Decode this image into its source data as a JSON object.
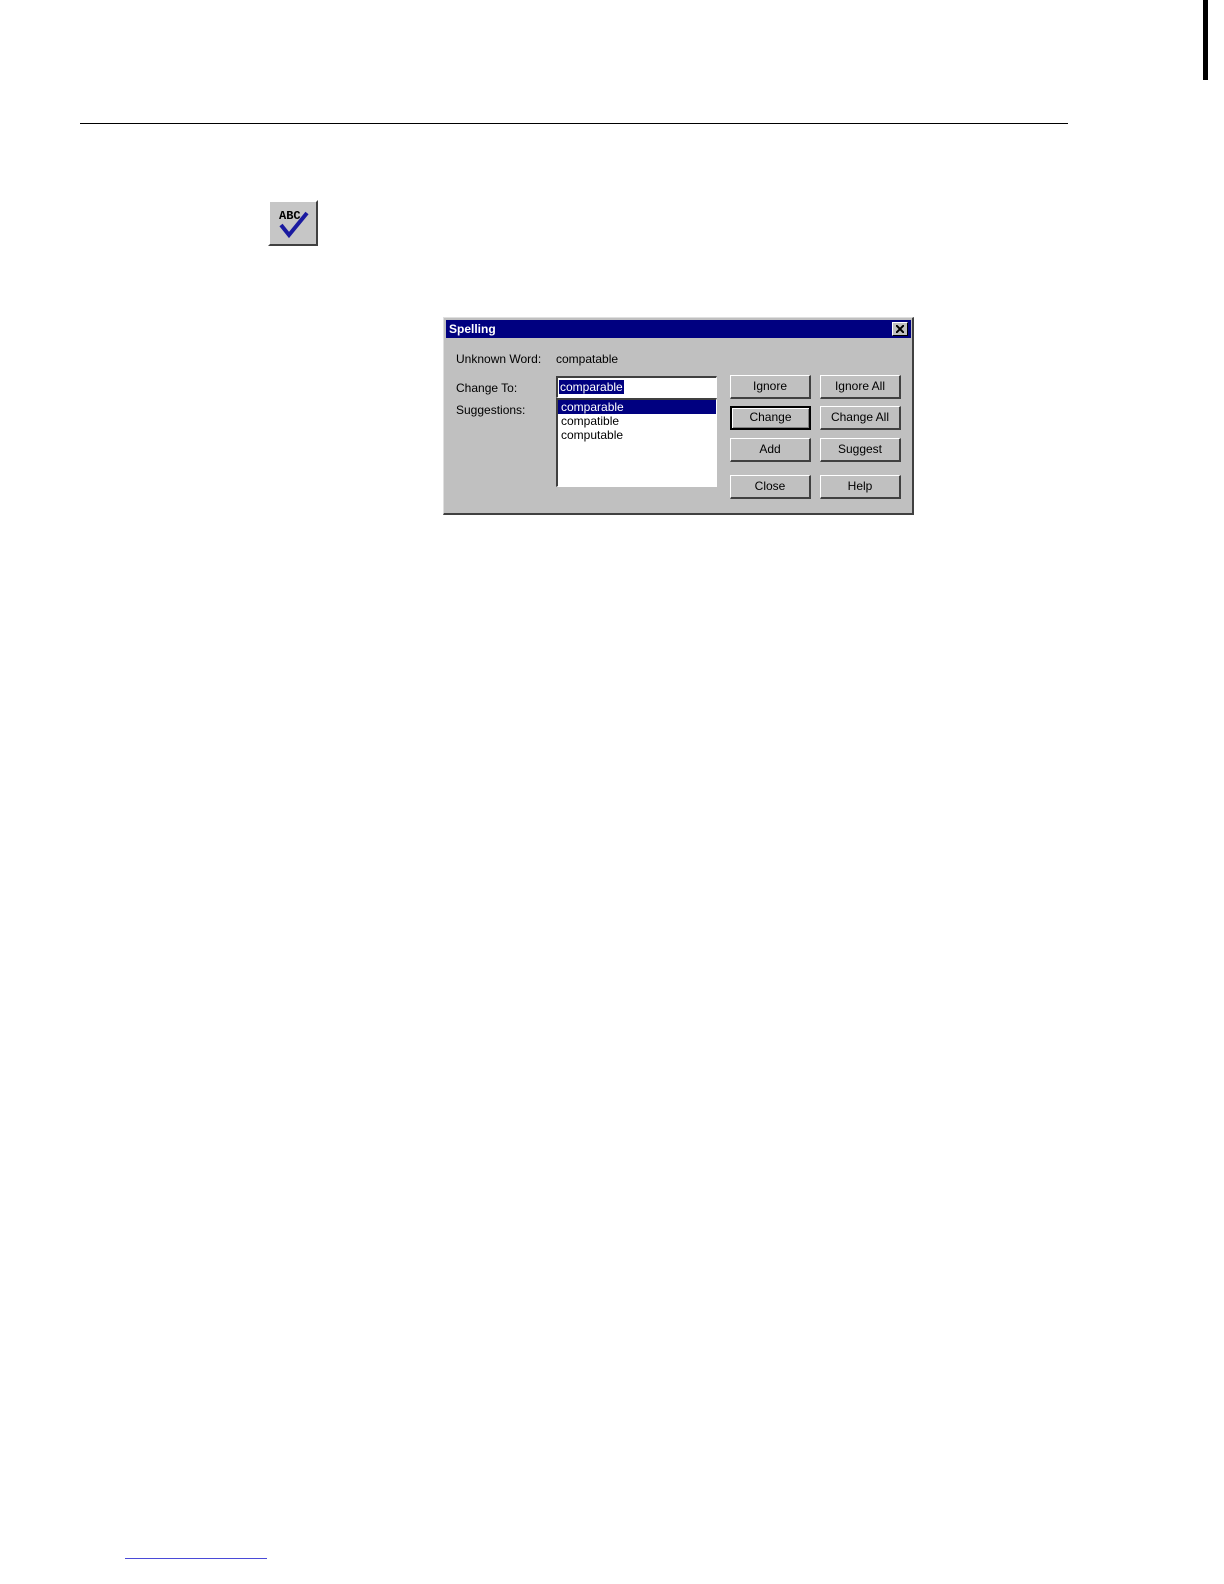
{
  "toolbar_icon": {
    "icon": "spell-check-abc-icon",
    "label": "ABC"
  },
  "dialog": {
    "title": "Spelling",
    "unknown_word_label": "Unknown Word:",
    "unknown_word_value": "compatable",
    "change_to_label": "Change To:",
    "change_to_value": "comparable",
    "suggestions_label": "Suggestions:",
    "suggestions": [
      "comparable",
      "compatible",
      "computable"
    ],
    "selected_suggestion": "comparable",
    "buttons": {
      "ignore": "Ignore",
      "ignore_all": "Ignore All",
      "change": "Change",
      "change_all": "Change All",
      "add": "Add",
      "suggest": "Suggest",
      "close": "Close",
      "help": "Help"
    }
  },
  "colors": {
    "titlebar": "#000080",
    "dialog_face": "#c0c0c0",
    "selection": "#000080",
    "check_mark": "#1a1aa0"
  }
}
